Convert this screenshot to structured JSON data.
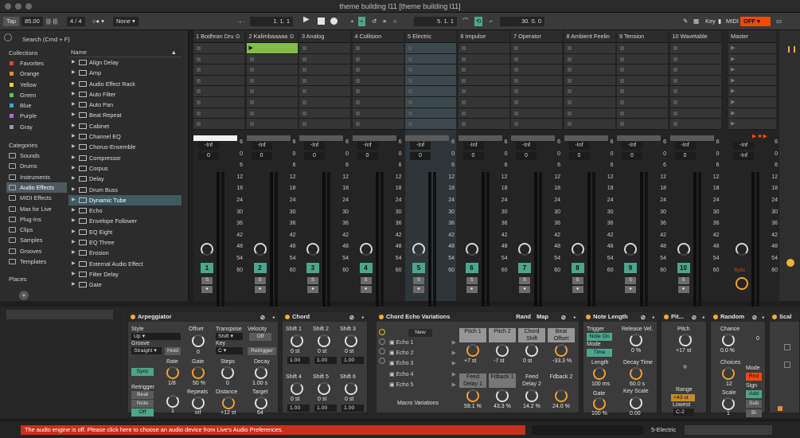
{
  "window": {
    "title": "theme building l11  [theme building l11]"
  },
  "toolbar": {
    "tap": "Tap",
    "tempo": "85.00",
    "meter": "4 / 4",
    "groove_none": "None",
    "position": "1.   1.   1",
    "loop_start": "5.   1.   1",
    "loop_length": "30.   0.   0",
    "key": "Key",
    "midi": "MIDI",
    "audio_off": "OFF"
  },
  "browser": {
    "search": "Search (Cmd + F)",
    "collections_label": "Collections",
    "collections": [
      {
        "label": "Favorites",
        "color": "#e0403a"
      },
      {
        "label": "Orange",
        "color": "#f08a30"
      },
      {
        "label": "Yellow",
        "color": "#e8d03a"
      },
      {
        "label": "Green",
        "color": "#5cc65a"
      },
      {
        "label": "Blue",
        "color": "#3aa6e0"
      },
      {
        "label": "Purple",
        "color": "#b06ad8"
      },
      {
        "label": "Gray",
        "color": "#9a9a9a"
      }
    ],
    "categories_label": "Categories",
    "categories": [
      "Sounds",
      "Drums",
      "Instruments",
      "Audio Effects",
      "MIDI Effects",
      "Max for Live",
      "Plug-Ins",
      "Clips",
      "Samples",
      "Grooves",
      "Templates"
    ],
    "selected_category": "Audio Effects",
    "places_label": "Places",
    "name_header": "Name",
    "items": [
      "Align Delay",
      "Amp",
      "Audio Effect Rack",
      "Auto Filter",
      "Auto Pan",
      "Beat Repeat",
      "Cabinet",
      "Channel EQ",
      "Chorus-Ensemble",
      "Compressor",
      "Corpus",
      "Delay",
      "Drum Buss",
      "Dynamic Tube",
      "Echo",
      "Envelope Follower",
      "EQ Eight",
      "EQ Three",
      "Erosion",
      "External Audio Effect",
      "Filter Delay",
      "Gate"
    ],
    "selected_item": "Dynamic Tube"
  },
  "tracks": [
    {
      "name": "1 Bodhran Dru",
      "num": "1"
    },
    {
      "name": "2 Kalimbaaaaa",
      "num": "2"
    },
    {
      "name": "3 Analog",
      "num": "3"
    },
    {
      "name": "4 Collision",
      "num": "4"
    },
    {
      "name": "5 Electric",
      "num": "5"
    },
    {
      "name": "6 Impulse",
      "num": "6"
    },
    {
      "name": "7 Operator",
      "num": "7"
    },
    {
      "name": "8 Ambient Feelin",
      "num": "8"
    },
    {
      "name": "9 Tension",
      "num": "9"
    },
    {
      "name": "10 Wavetable",
      "num": "10"
    }
  ],
  "master": {
    "name": "Master",
    "solo": "Solo"
  },
  "scene_numbers": [
    "1",
    "2",
    "3",
    "4",
    "5",
    "6",
    "7",
    "8"
  ],
  "mixer": {
    "inf": "-Inf",
    "zero": "0",
    "s": "S",
    "scale": [
      "6",
      "0",
      "6",
      "12",
      "18",
      "24",
      "30",
      "36",
      "42",
      "48",
      "54",
      "60"
    ]
  },
  "devices": {
    "arp": {
      "title": "Arpeggiator",
      "style": "Style",
      "style_val": "Up",
      "groove": "Groove",
      "groove_val": "Straight",
      "hold": "Hold",
      "offset": "Offset",
      "offset_val": "0",
      "transpose": "Transpose",
      "transpose_val": "Shift",
      "key": "Key",
      "key_val": "C",
      "velocity": "Velocity",
      "velocity_val": "Off",
      "retrigger_btn": "Retrigger",
      "sync": "Sync",
      "rate": "Rate",
      "rate_val": "1/8",
      "gate": "Gate",
      "gate_val": "50 %",
      "steps": "Steps",
      "steps_val": "0",
      "decay": "Decay",
      "decay_val": "1.00 s",
      "retrigger": "Retrigger",
      "beat": "Beat",
      "note": "Note",
      "off": "Off",
      "repeats": "Repeats",
      "repeats_val": "inf",
      "distance": "Distance",
      "distance_val": "+12 st",
      "target": "Target",
      "target_val": "64",
      "one": "1"
    },
    "chord": {
      "title": "Chord",
      "shifts": [
        "Shift 1",
        "Shift 2",
        "Shift 3",
        "Shift 4",
        "Shift 5",
        "Shift 6"
      ],
      "st": "0 st",
      "vel": "1.00"
    },
    "rack": {
      "title": "Chord Echo Variations",
      "rand": "Rand",
      "map": "Map",
      "new": "New",
      "chains": [
        "Echo 1",
        "Echo 2",
        "Echo 3",
        "Echo 4",
        "Echo 5"
      ],
      "macro_label": "Macro Variations",
      "macros": [
        {
          "label": "Pitch 1",
          "val": "+7 st"
        },
        {
          "label": "Pitch 2",
          "val": "-7 st"
        },
        {
          "label": "Chord Shift",
          "val": "0 st"
        },
        {
          "label": "Beat Offset",
          "val": "-33.3 %"
        },
        {
          "label": "Feed Delay 1",
          "val": "59.1 %"
        },
        {
          "label": "Fdback 1",
          "val": "43.3 %"
        },
        {
          "label": "Feed Delay 2",
          "val": "14.2 %"
        },
        {
          "label": "Fdback 2",
          "val": "24.0 %"
        }
      ]
    },
    "notelen": {
      "title": "Note Length",
      "trigger": "Trigger",
      "trigger_val": "Note On",
      "mode": "Mode",
      "mode_val": "Time",
      "release": "Release Vel.",
      "release_val": "0 %",
      "length": "Length",
      "length_val": "100 ms",
      "decay": "Decay Time",
      "decay_val": "60.0 s",
      "gate": "Gate",
      "gate_val": "100 %",
      "keyscale": "Key Scale",
      "keyscale_val": "0.00"
    },
    "pitch": {
      "title": "Pit...",
      "pitch": "Pitch",
      "pitch_val": "+17 st",
      "range": "Range",
      "range_val": "+43 st",
      "lowest": "Lowest",
      "lowest_val": "C-2"
    },
    "random": {
      "title": "Random",
      "chance": "Chance",
      "chance_val": "0.0 %",
      "choices": "Choices",
      "choices_val": "12",
      "mode": "Mode",
      "mode_val": "Rnd",
      "scale": "Scale",
      "scale_val": "1",
      "sign": "Sign",
      "add": "Add",
      "sub": "Sub",
      "bi": "Bi",
      "zero": "0"
    },
    "scale": {
      "title": "Scal"
    }
  },
  "status": {
    "message": "The audio engine is off. Please click here to choose an audio device from Live's Audio Preferences.",
    "track": "5-Electric"
  }
}
